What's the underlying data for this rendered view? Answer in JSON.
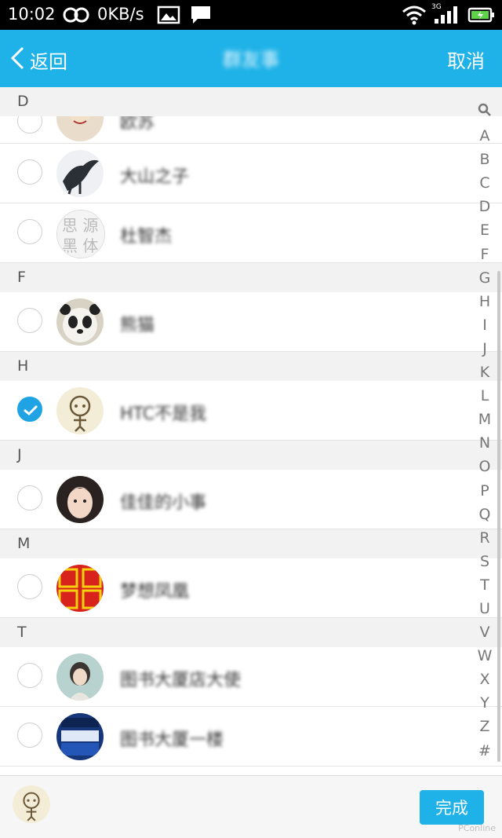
{
  "status_bar": {
    "time": "10:02",
    "speed": "0KB/s",
    "network": "3G"
  },
  "nav": {
    "back_label": "返回",
    "title": "群友事",
    "cancel_label": "取消"
  },
  "sections": [
    {
      "letter": "D",
      "rows": [
        {
          "name": "欧苏",
          "checked": false,
          "partial": true
        },
        {
          "name": "大山之子",
          "checked": false
        },
        {
          "name": "杜智杰",
          "checked": false
        }
      ]
    },
    {
      "letter": "F",
      "rows": [
        {
          "name": "熊猫",
          "checked": false
        }
      ]
    },
    {
      "letter": "H",
      "rows": [
        {
          "name": "HTC不是我",
          "checked": true
        }
      ]
    },
    {
      "letter": "J",
      "rows": [
        {
          "name": "佳佳的小事",
          "checked": false
        }
      ]
    },
    {
      "letter": "M",
      "rows": [
        {
          "name": "梦想凤凰",
          "checked": false
        }
      ]
    },
    {
      "letter": "T",
      "rows": [
        {
          "name": "图书大厦店大使",
          "checked": false
        },
        {
          "name": "图书大厦一楼",
          "checked": false
        }
      ]
    }
  ],
  "index": [
    "A",
    "B",
    "C",
    "D",
    "E",
    "F",
    "G",
    "H",
    "I",
    "J",
    "K",
    "L",
    "M",
    "N",
    "O",
    "P",
    "Q",
    "R",
    "S",
    "T",
    "U",
    "V",
    "W",
    "X",
    "Y",
    "Z",
    "#"
  ],
  "bottom": {
    "done_label": "完成",
    "watermark": "PConline"
  }
}
